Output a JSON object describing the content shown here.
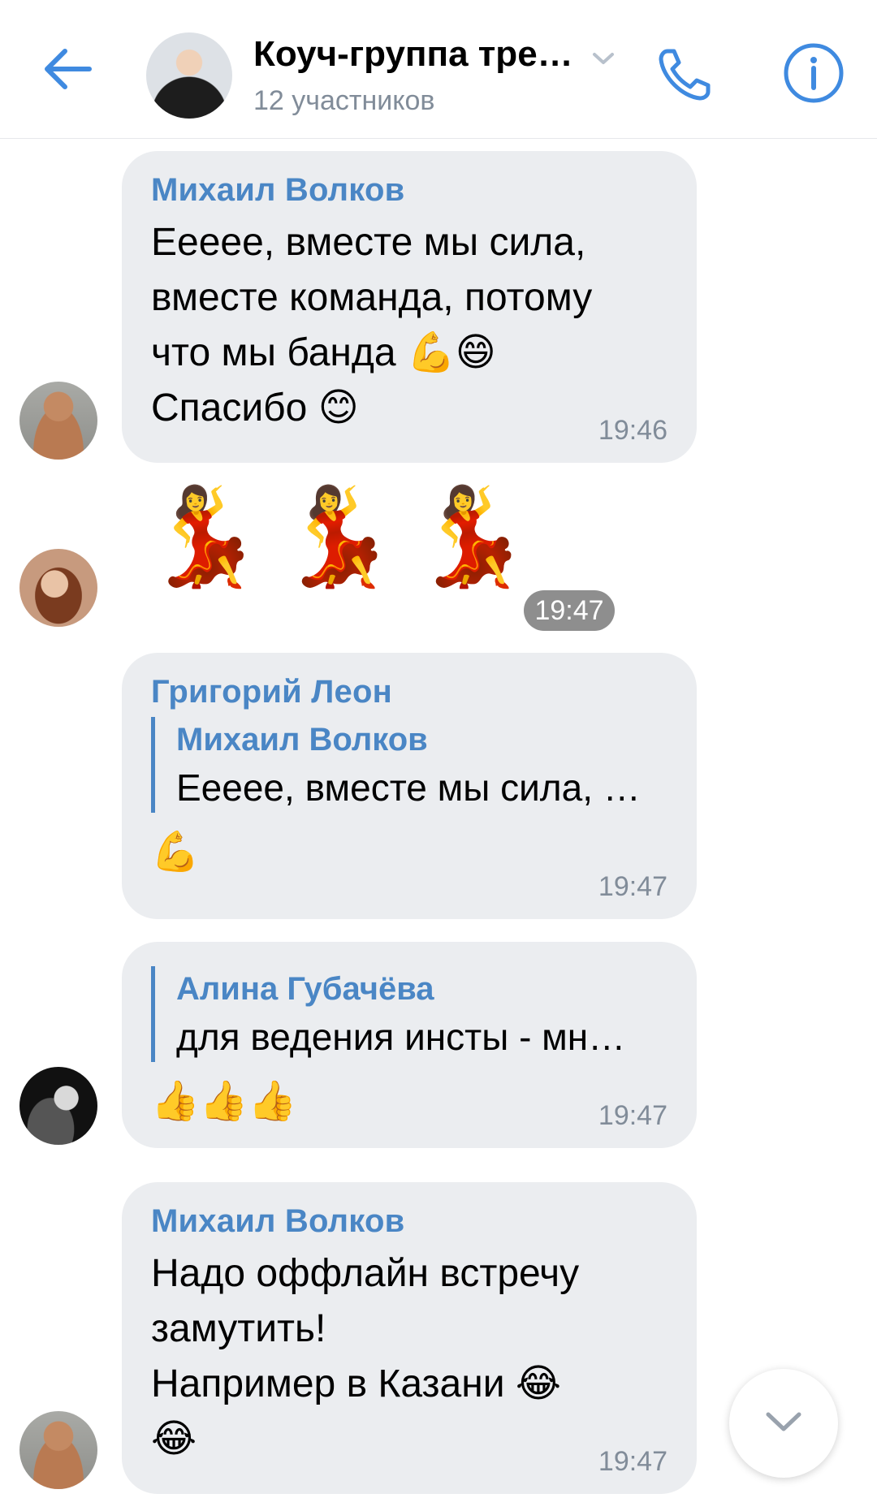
{
  "header": {
    "title": "Коуч-группа тре…",
    "subtitle": "12 участников",
    "back_icon": "arrow-left-icon",
    "call_icon": "phone-icon",
    "info_icon": "info-icon",
    "accent": "#3f8ae0"
  },
  "messages": [
    {
      "author": "Михаил Волков",
      "lines": [
        "Ееееe, вместе мы сила,",
        "вместе команда, потому",
        "что мы банда 💪😄",
        "Спасибо 😊"
      ],
      "time": "19:46"
    },
    {
      "emoji": "💃💃💃",
      "time": "19:47"
    },
    {
      "author": "Григорий Леон",
      "reply_author": "Михаил Волков",
      "reply_text": "Ееееe, вместе мы сила, …",
      "body": "💪",
      "time": "19:47"
    },
    {
      "reply_author": "Алина Губачёва",
      "reply_text": "для ведения инсты - мн…",
      "body": "👍👍👍",
      "time": "19:47"
    },
    {
      "author": "Михаил Волков",
      "lines": [
        "Надо оффлайн встречу",
        "замутить!",
        "Например в Казани 😂",
        "😂"
      ],
      "time": "19:47"
    }
  ],
  "scroll_button_icon": "chevron-down-icon"
}
